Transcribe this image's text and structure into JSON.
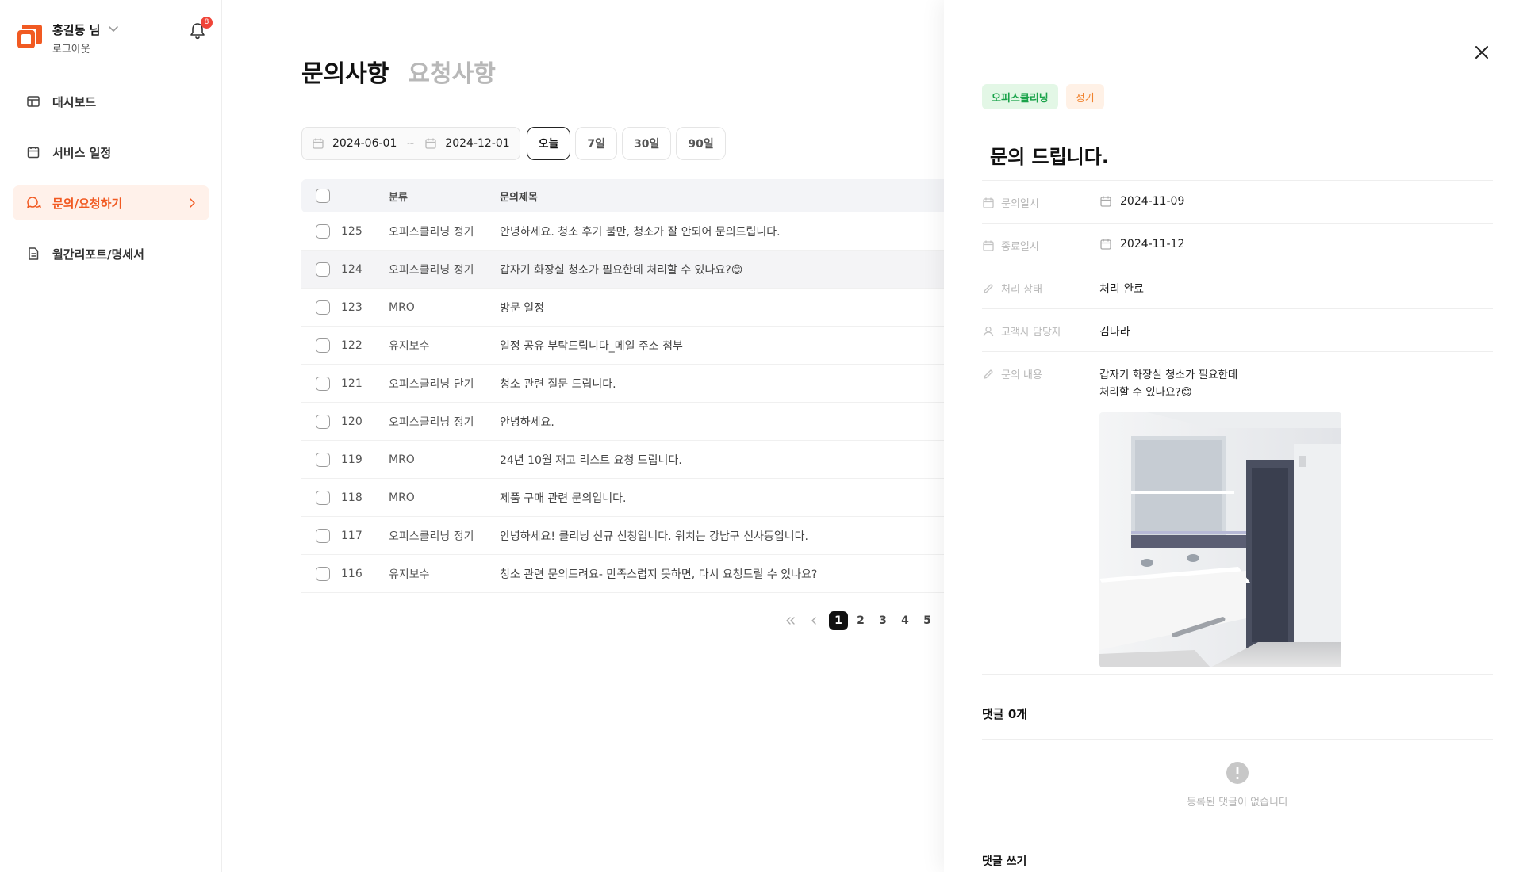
{
  "user": {
    "name": "홍길동 님",
    "logout_label": "로그아웃",
    "notification_count": "8"
  },
  "colors": {
    "brand": "#f15a22",
    "tag_green_bg": "#e3f7e6",
    "tag_green_text": "#1aa34a",
    "tag_orange_bg": "#fff1e6",
    "tag_orange_text": "#f1832f",
    "badge": "#f04438"
  },
  "sidebar": {
    "items": [
      {
        "label": "대시보드",
        "icon": "dashboard-icon",
        "active": false
      },
      {
        "label": "서비스 일정",
        "icon": "calendar-icon",
        "active": false
      },
      {
        "label": "문의/요청하기",
        "icon": "chat-icon",
        "active": true
      },
      {
        "label": "월간리포트/명세서",
        "icon": "document-icon",
        "active": false
      }
    ]
  },
  "main": {
    "tabs": [
      {
        "label": "문의사항",
        "active": true
      },
      {
        "label": "요청사항",
        "active": false
      }
    ],
    "filter": {
      "start_date": "2024-06-01",
      "separator": "~",
      "end_date": "2024-12-01",
      "quick": [
        {
          "label": "오늘",
          "active": true
        },
        {
          "label": "7일",
          "active": false
        },
        {
          "label": "30일",
          "active": false
        },
        {
          "label": "90일",
          "active": false
        }
      ]
    },
    "table": {
      "headers": {
        "category": "분류",
        "title": "문의제목"
      },
      "rows": [
        {
          "num": "125",
          "category": "오피스클리닝 정기",
          "title": "안녕하세요. 청소 후기 불만, 청소가 잘 안되어 문의드립니다."
        },
        {
          "num": "124",
          "category": "오피스클리닝 정기",
          "title": "갑자기 화장실 청소가 필요한데 처리할 수 있나요?😊"
        },
        {
          "num": "123",
          "category": "MRO",
          "title": "방문 일정"
        },
        {
          "num": "122",
          "category": "유지보수",
          "title": "일정 공유 부탁드립니다_메일 주소 첨부"
        },
        {
          "num": "121",
          "category": "오피스클리닝 단기",
          "title": "청소 관련 질문 드립니다."
        },
        {
          "num": "120",
          "category": "오피스클리닝 정기",
          "title": "안녕하세요."
        },
        {
          "num": "119",
          "category": "MRO",
          "title": "24년 10월 재고 리스트 요청 드립니다."
        },
        {
          "num": "118",
          "category": "MRO",
          "title": "제품 구매 관련 문의입니다."
        },
        {
          "num": "117",
          "category": "오피스클리닝 정기",
          "title": "안녕하세요! 클리닝 신규 신청입니다. 위치는 강남구 신사동입니다."
        },
        {
          "num": "116",
          "category": "유지보수",
          "title": "청소 관련 문의드려요- 만족스럽지 못하면, 다시 요청드릴 수 있나요?"
        }
      ]
    },
    "pagination": {
      "pages": [
        "1",
        "2",
        "3",
        "4",
        "5"
      ],
      "current": "1"
    }
  },
  "detail": {
    "tags": [
      "오피스클리닝",
      "정기"
    ],
    "title": "문의 드립니다.",
    "fields": {
      "inquiry_date_label": "문의일시",
      "inquiry_date": "2024-11-09",
      "end_date_label": "종료일시",
      "end_date": "2024-11-12",
      "status_label": "처리 상태",
      "status": "처리 완료",
      "manager_label": "고객사 담당자",
      "manager": "김나라",
      "content_label": "문의 내용",
      "content": "갑자기 화장실 청소가 필요한데\n처리할 수 있나요?😊"
    },
    "comments": {
      "title": "댓글 0개",
      "empty_text": "등록된 댓글이 없습니다",
      "write_label": "댓글 쓰기"
    }
  }
}
